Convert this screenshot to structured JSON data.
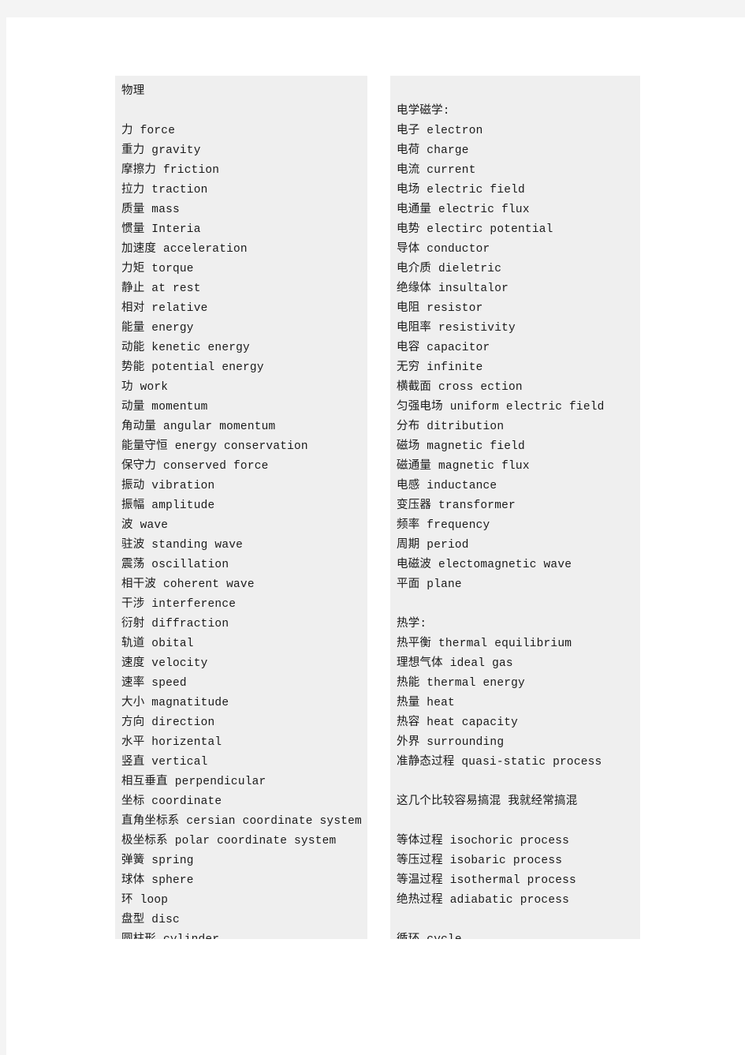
{
  "colors": {
    "page_background": "#ffffff",
    "panel_background": "#efefef",
    "chrome_band": "#f4f4f4",
    "text": "#1a1a1a"
  },
  "columns": {
    "left": {
      "title": "物理",
      "lines": [
        "物理",
        "",
        "力 force",
        "重力 gravity",
        "摩擦力 friction",
        "拉力 traction",
        "质量 mass",
        "惯量 Interia",
        "加速度 acceleration",
        "力矩 torque",
        "静止 at rest",
        "相对 relative",
        "能量 energy",
        "动能 kenetic energy",
        "势能 potential energy",
        "功 work",
        "动量 momentum",
        "角动量 angular momentum",
        "能量守恒 energy conservation",
        "保守力 conserved force",
        "振动 vibration",
        "振幅 amplitude",
        "波 wave",
        "驻波 standing wave",
        "震荡 oscillation",
        "相干波 coherent wave",
        "干涉 interference",
        "衍射 diffraction",
        "轨道 obital",
        "速度 velocity",
        "速率 speed",
        "大小 magnatitude",
        "方向 direction",
        "水平 horizental",
        "竖直 vertical",
        "相互垂直 perpendicular",
        "坐标 coordinate",
        "直角坐标系 cersian coordinate system",
        "极坐标系 polar coordinate system",
        "弹簧 spring",
        "球体 sphere",
        "环 loop",
        "盘型 disc",
        "圆柱形 cylinder"
      ]
    },
    "right": {
      "section_electromagnetism": "电学磁学:",
      "section_thermodynamics": "热学:",
      "note": "这几个比较容易搞混 我就经常搞混",
      "lines": [
        "",
        "电学磁学:",
        "电子 electron",
        "电荷 charge",
        "电流 current",
        "电场 electric field",
        "电通量 electric flux",
        "电势 electirc potential",
        "导体 conductor",
        "电介质 dieletric",
        "绝缘体 insultalor",
        "电阻 resistor",
        "电阻率 resistivity",
        "电容 capacitor",
        "无穷 infinite",
        "横截面 cross ection",
        "匀强电场 uniform electric field",
        "分布 ditribution",
        "磁场 magnetic field",
        "磁通量 magnetic flux",
        "电感 inductance",
        "变压器 transformer",
        "频率 frequency",
        "周期 period",
        "电磁波 electomagnetic wave",
        "平面 plane",
        "",
        "热学:",
        "热平衡 thermal equilibrium",
        "理想气体 ideal gas",
        "热能 thermal energy",
        "热量 heat",
        "热容 heat capacity",
        "外界 surrounding",
        "准静态过程 quasi-static process",
        "",
        "这几个比较容易搞混 我就经常搞混",
        "",
        "等体过程 isochoric process",
        "等压过程 isobaric process",
        "等温过程 isothermal process",
        "绝热过程 adiabatic process",
        "",
        "循环 cycle"
      ]
    }
  }
}
